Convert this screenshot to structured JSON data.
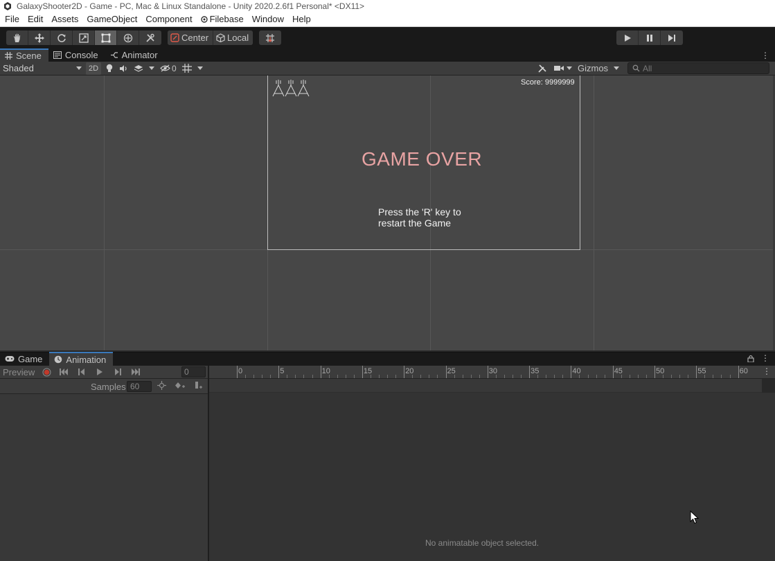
{
  "window": {
    "title": "GalaxyShooter2D - Game - PC, Mac & Linux Standalone - Unity 2020.2.6f1 Personal* <DX11>"
  },
  "menu": {
    "items": [
      "File",
      "Edit",
      "Assets",
      "GameObject",
      "Component",
      "Filebase",
      "Window",
      "Help"
    ]
  },
  "toolbar": {
    "pivot_label": "Center",
    "space_label": "Local"
  },
  "scene_tabs": {
    "scene": "Scene",
    "console": "Console",
    "animator": "Animator"
  },
  "scene_toolbar": {
    "draw_mode": "Shaded",
    "mode_2d": "2D",
    "hidden_count": "0",
    "gizmos": "Gizmos",
    "search_placeholder": "All"
  },
  "game_view": {
    "score": "Score: 9999999",
    "game_over": "GAME OVER",
    "restart_line1": "Press the 'R' key to",
    "restart_line2": "restart the Game"
  },
  "bottom_tabs": {
    "game": "Game",
    "animation": "Animation"
  },
  "animation": {
    "preview": "Preview",
    "frame": "0",
    "samples_label": "Samples",
    "samples_value": "60",
    "timeline_ticks": [
      "0",
      "5",
      "10",
      "15",
      "20",
      "25",
      "30",
      "35",
      "40",
      "45",
      "50",
      "55",
      "60"
    ],
    "empty_message": "No animatable object selected."
  },
  "colors": {
    "accent": "#3a79bb",
    "game_over_text": "#e8a3a3",
    "record": "#c0392b"
  }
}
